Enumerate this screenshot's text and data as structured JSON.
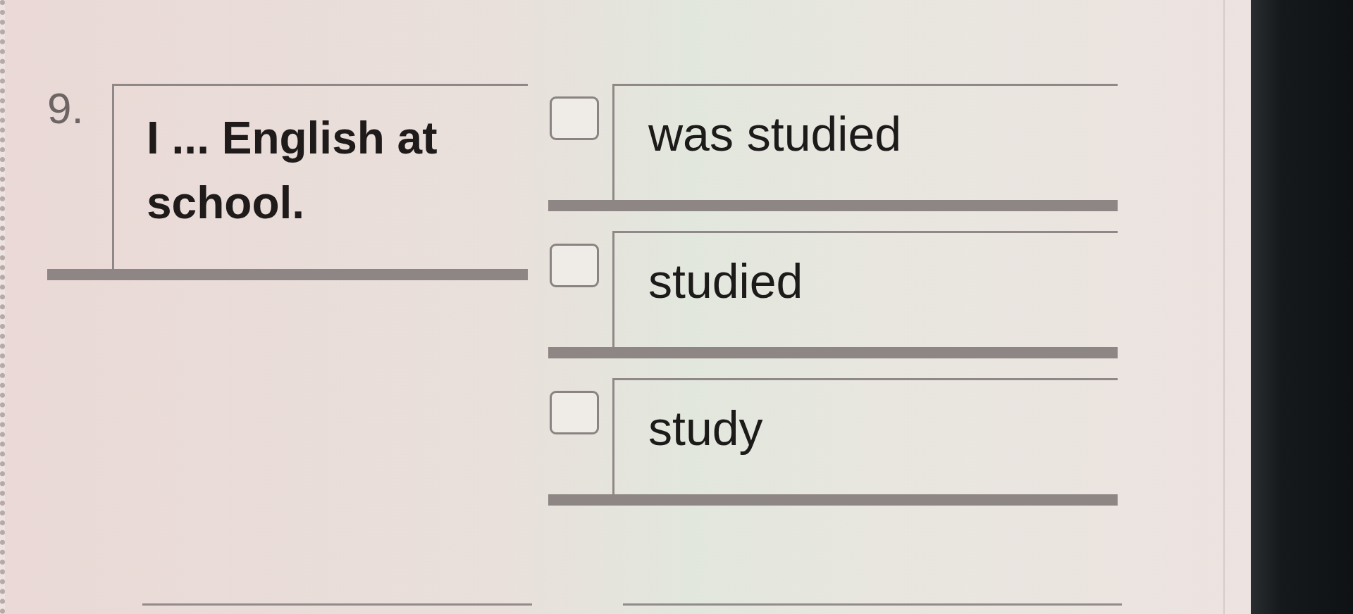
{
  "question": {
    "number": "9.",
    "text": "I ... English at school."
  },
  "options": [
    {
      "label": "was studied",
      "checked": false
    },
    {
      "label": "studied",
      "checked": false
    },
    {
      "label": "study",
      "checked": false
    }
  ]
}
